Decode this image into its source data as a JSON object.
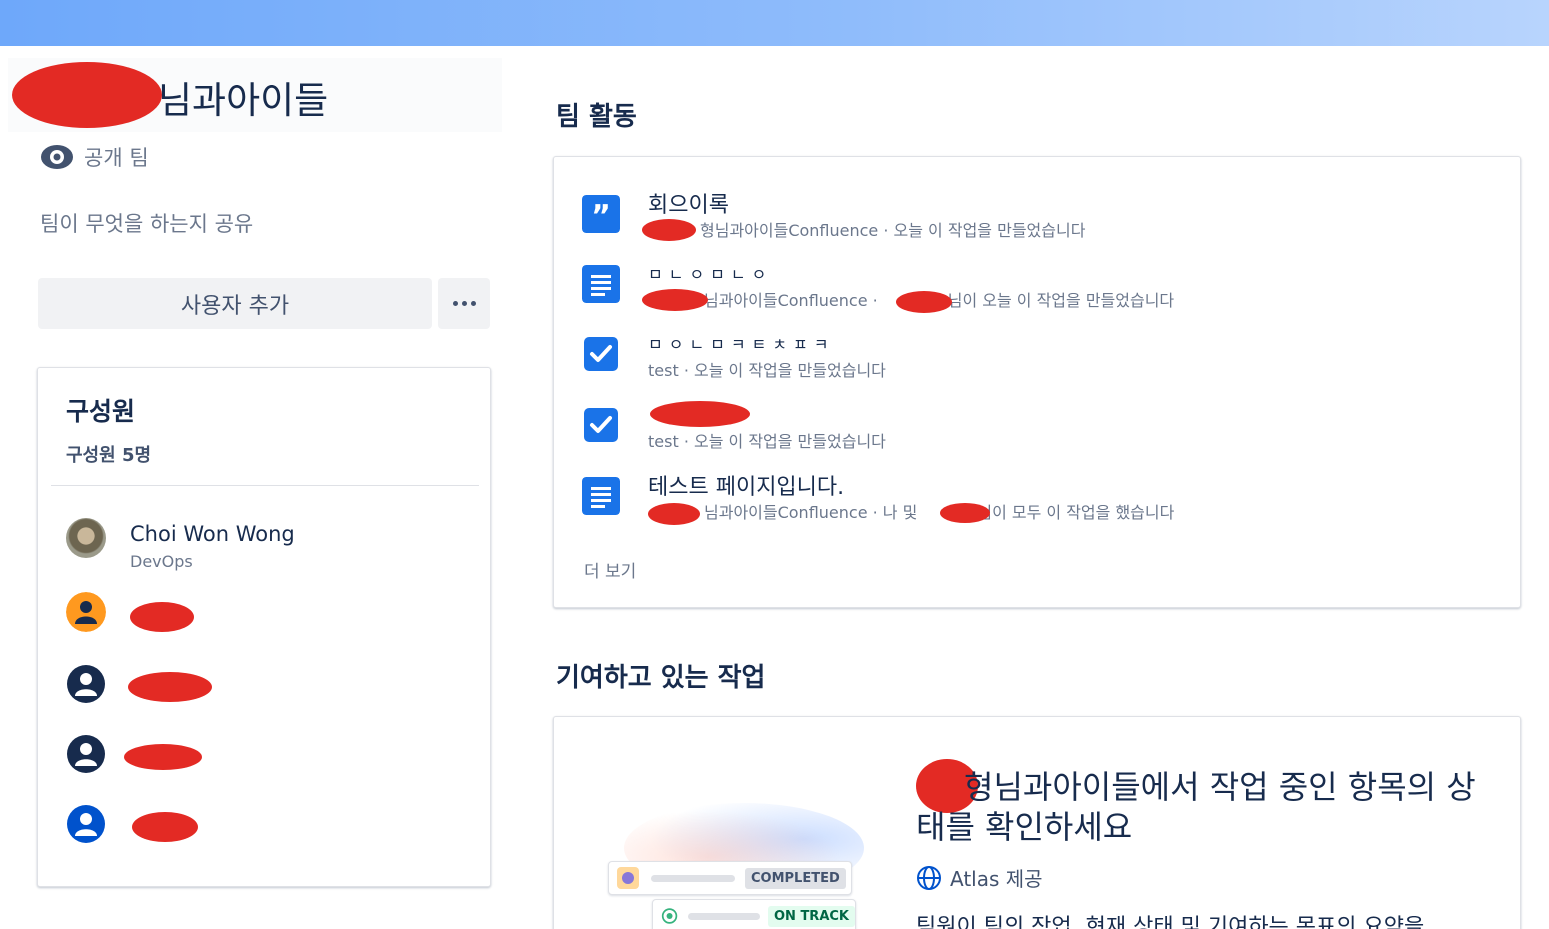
{
  "team": {
    "name": "님과아이들",
    "visibility": "공개 팀",
    "description_placeholder": "팀이 무엇을 하는지 공유",
    "add_user_label": "사용자 추가"
  },
  "members": {
    "title": "구성원",
    "count": "구성원 5명",
    "list": [
      {
        "name": "Choi Won Wong",
        "role": "DevOps"
      },
      {
        "name": "",
        "role": ""
      },
      {
        "name": "",
        "role": ""
      },
      {
        "name": "",
        "role": ""
      },
      {
        "name": "",
        "role": ""
      }
    ]
  },
  "activity": {
    "title": "팀 활동",
    "items": [
      {
        "title": "회으이록",
        "meta": "형님과아이들Confluence · 오늘 이 작업을 만들었습니다",
        "icon": "quote-icon"
      },
      {
        "title": "ㅁㄴㅇㅁㄴㅇ",
        "meta": "님과아이들Confluence ·",
        "meta2": "님이 오늘 이 작업을 만들었습니다",
        "icon": "page-icon"
      },
      {
        "title": "ㅁㅇㄴㅁㅋㅌㅊㅍㅋ",
        "meta": "test · 오늘 이 작업을 만들었습니다",
        "icon": "checkbox-icon"
      },
      {
        "title": "",
        "meta": "test · 오늘 이 작업을 만들었습니다",
        "icon": "checkbox-icon"
      },
      {
        "title": "테스트 페이지입니다.",
        "meta": "님과아이들Confluence · 나 및",
        "meta2": "님이 모두 이 작업을 했습니다",
        "icon": "page-icon"
      }
    ],
    "more_label": "더 보기"
  },
  "work": {
    "title": "기여하고 있는 작업",
    "heading": "형님과아이들에서 작업 중인 항목의 상태를 확인하세요",
    "provider": "Atlas 제공",
    "description": "팀원이 팀의 작업, 현재 상태 및 기여하는 목표의 요약을",
    "status_completed": "COMPLETED",
    "status_on_track": "ON TRACK"
  },
  "colors": {
    "accent": "#0052cc",
    "redaction": "#e32a24",
    "completed_bg": "#dfe1e6",
    "on_track_text": "#006644"
  }
}
